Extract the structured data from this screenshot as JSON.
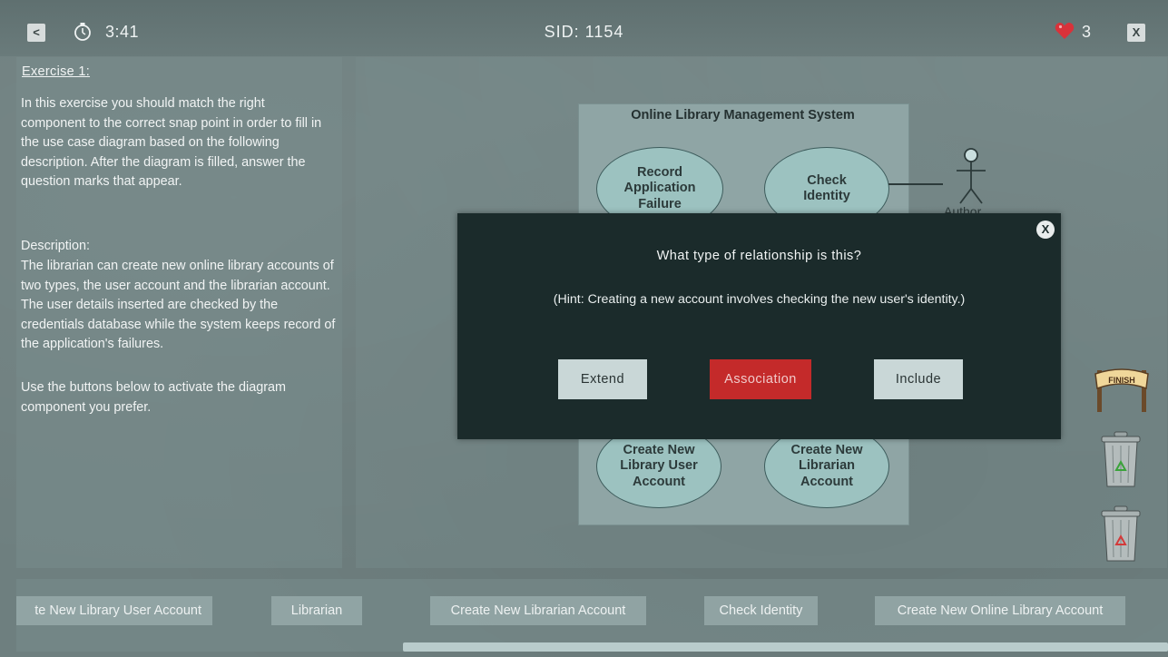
{
  "header": {
    "back_label": "<",
    "timer": "3:41",
    "session_id": "SID: 1154",
    "lives": "3",
    "close_label": "X"
  },
  "exercise": {
    "title": "Exercise 1:",
    "intro": "In this exercise you should match the right component to the correct snap point in order to fill in the use case diagram based on the following description. After the diagram is filled, answer the question marks that appear.",
    "description_label": "Description:",
    "description": "The librarian can create new online library accounts of two types, the user account and the librarian account. The user details inserted are checked by the credentials database while the system keeps record of the application's failures.",
    "instruction": "Use the buttons below to activate the diagram component you prefer."
  },
  "diagram": {
    "system_title": "Online Library Management System",
    "use_cases": {
      "record": "Record Application Failure",
      "check": "Check Identity",
      "create_user": "Create New Library User Account",
      "create_librarian": "Create New Librarian Account"
    },
    "actor_label": "Author"
  },
  "modal": {
    "close_label": "X",
    "question": "What type of relationship is this?",
    "hint": "(Hint: Creating a new account involves checking the new user's identity.)",
    "options": [
      "Extend",
      "Association",
      "Include"
    ]
  },
  "side": {
    "finish_label": "FINISH"
  },
  "tray": {
    "components": [
      "te New Library User Account",
      "Librarian",
      "Create New Librarian Account",
      "Check Identity",
      "Create New Online Library Account"
    ]
  },
  "colors": {
    "modal_bg": "#1b2b2b",
    "selected_option": "#c42a2a",
    "heart": "#d9323a"
  }
}
